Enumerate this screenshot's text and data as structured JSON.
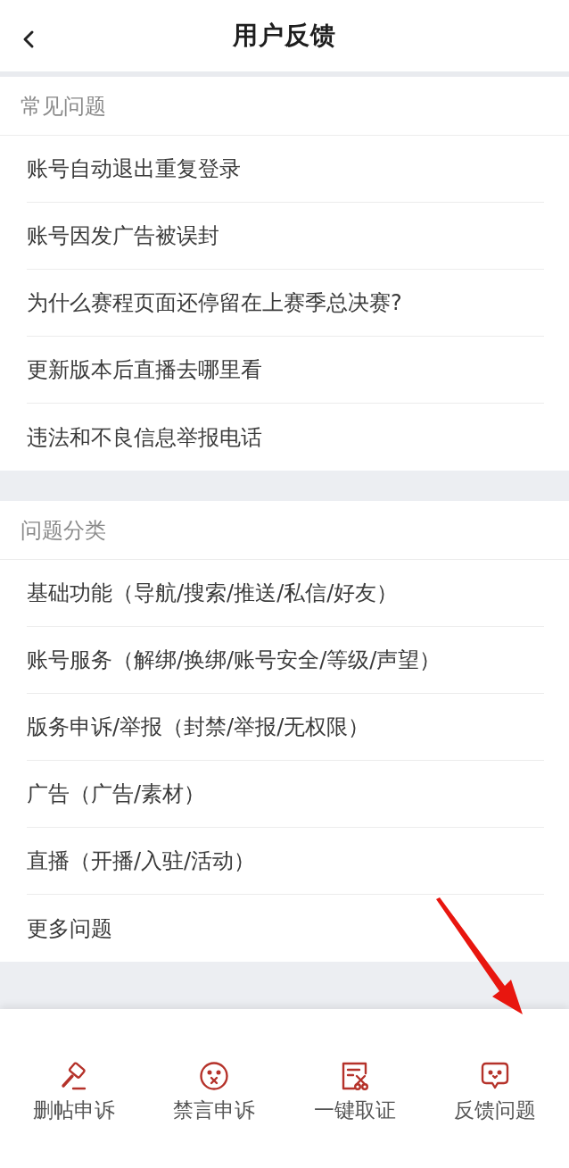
{
  "header": {
    "title": "用户反馈"
  },
  "sections": [
    {
      "title": "常见问题",
      "items": [
        "账号自动退出重复登录",
        "账号因发广告被误封",
        "为什么赛程页面还停留在上赛季总决赛?",
        "更新版本后直播去哪里看",
        "违法和不良信息举报电话"
      ]
    },
    {
      "title": "问题分类",
      "items": [
        "基础功能（导航/搜索/推送/私信/好友）",
        "账号服务（解绑/换绑/账号安全/等级/声望）",
        "版务申诉/举报（封禁/举报/无权限）",
        "广告（广告/素材）",
        "直播（开播/入驻/活动）",
        "更多问题"
      ]
    }
  ],
  "bottom_tabs": [
    {
      "label": "删帖申诉"
    },
    {
      "label": "禁言申诉"
    },
    {
      "label": "一键取证"
    },
    {
      "label": "反馈问题"
    }
  ]
}
